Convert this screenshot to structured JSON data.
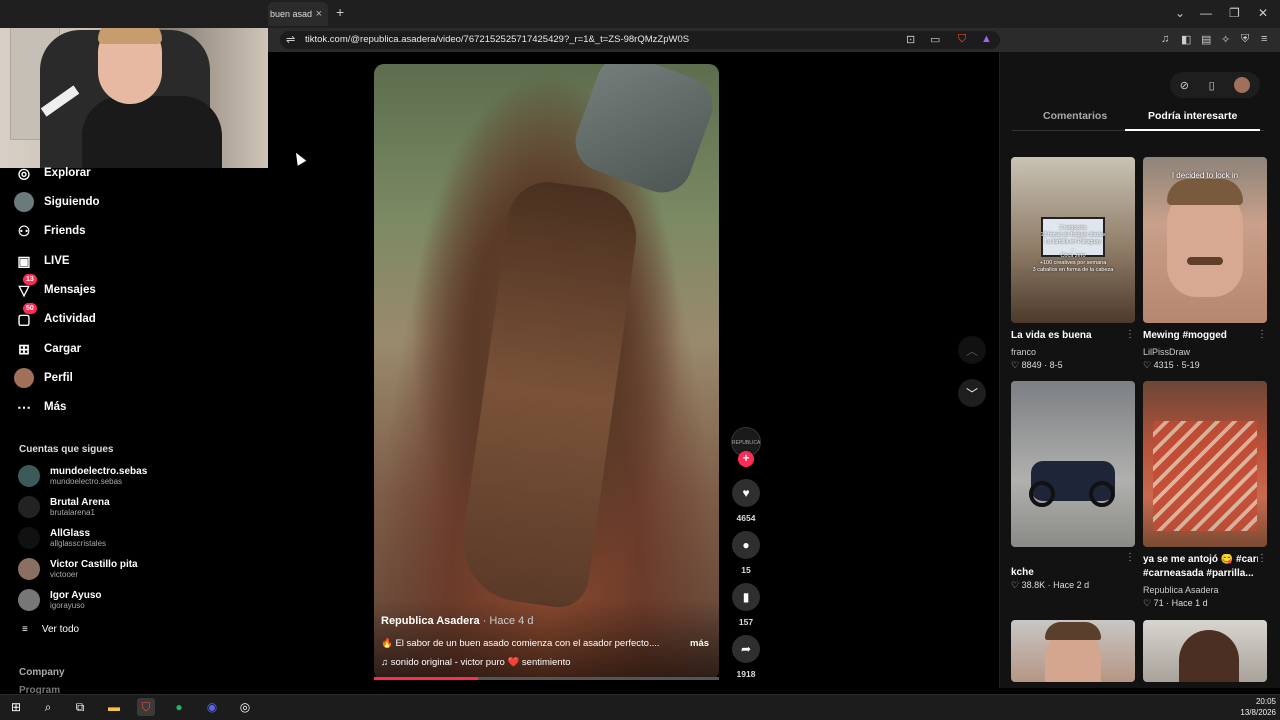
{
  "browser": {
    "tab_title": "buen asad",
    "tab_close": "×",
    "new_tab": "+",
    "url": "tiktok.com/@republica.asadera/video/7672152525717425429?_r=1&_t=ZS-98rQMzZpW0S",
    "window_controls": [
      "⌄",
      "—",
      "❐",
      "✕"
    ]
  },
  "sidebar": {
    "items": [
      {
        "label": "Explorar",
        "icon": "compass-icon",
        "glyph": "◎"
      },
      {
        "label": "Siguiendo",
        "icon": "avatar-icon",
        "glyph": ""
      },
      {
        "label": "Friends",
        "icon": "friends-icon",
        "glyph": "👥"
      },
      {
        "label": "LIVE",
        "icon": "live-icon",
        "glyph": "▣"
      },
      {
        "label": "Mensajes",
        "icon": "messages-icon",
        "glyph": "▽",
        "badge": "13"
      },
      {
        "label": "Actividad",
        "icon": "activity-icon",
        "glyph": "▢",
        "badge": "50"
      },
      {
        "label": "Cargar",
        "icon": "upload-icon",
        "glyph": "⊞"
      },
      {
        "label": "Perfil",
        "icon": "profile-icon",
        "glyph": ""
      },
      {
        "label": "Más",
        "icon": "more-icon",
        "glyph": "⋯"
      }
    ],
    "following_title": "Cuentas que sigues",
    "following": [
      {
        "name": "mundoelectro.sebas",
        "user": "mundoelectro.sebas"
      },
      {
        "name": "Brutal Arena",
        "user": "brutalarena1"
      },
      {
        "name": "AllGlass",
        "user": "allglasscristales"
      },
      {
        "name": "Victor Castillo pita",
        "user": "victooer"
      },
      {
        "name": "Igor Ayuso",
        "user": "igorayuso"
      }
    ],
    "see_all": "Ver todo",
    "company": "Company",
    "program": "Program"
  },
  "video": {
    "author": "Republica Asadera",
    "ago": " · Hace 4 d",
    "description": "🔥 El sabor de un buen asado comienza con el asador perfecto....",
    "more": "más",
    "music": "♫  sonido original - victor puro ❤️ sentimiento",
    "progress": 0.3,
    "creator_logo": "REPUBLICA"
  },
  "actions": {
    "likes": "4654",
    "comments": "15",
    "saves": "157",
    "shares": "1918"
  },
  "right_panel": {
    "tabs": [
      "Comentarios",
      "Podría interesarte"
    ],
    "active_tab": 1,
    "cards": [
      {
        "title": "La vida es buena",
        "author": "franco",
        "meta": "♡ 8849 · 8-5",
        "overlay": "2 negocios\n12 horas de trabajo diarias\nLa familia en Paraguay\n...\nCoca zero\n+100 creatives por semana\n3 caballos en forma de la cabeza"
      },
      {
        "title": "Mewing #mogged",
        "author": "LilPissDraw",
        "meta": "♡ 4315 · 5-19",
        "overlay": "I decided to lock in"
      },
      {
        "title": "kche",
        "author": "",
        "meta": "♡ 38.8K · Hace 2 d",
        "overlay": ""
      },
      {
        "title": "ya se me antojó 😋 #carneasada #parrilla...",
        "author": "Republica Asadera",
        "meta": "♡ 71 · Hace 1 d",
        "overlay": ""
      }
    ]
  },
  "taskbar": {
    "time": "20:05",
    "date": "13/8/2026"
  }
}
